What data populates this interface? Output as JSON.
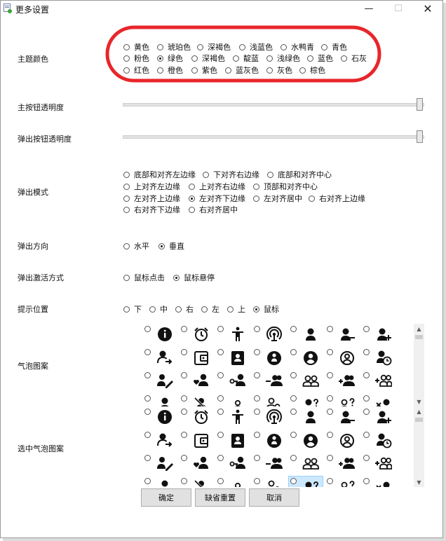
{
  "window": {
    "title": "更多设置"
  },
  "theme": {
    "label": "主题颜色",
    "selected": "绿色",
    "options": [
      "黄色",
      "琥珀色",
      "深褐色",
      "浅蓝色",
      "水鸭青",
      "青色",
      "粉色",
      "绿色",
      "深褐色",
      "靛蓝",
      "浅绿色",
      "蓝色",
      "石灰",
      "红色",
      "橙色",
      "紫色",
      "蓝灰色",
      "灰色",
      "棕色"
    ],
    "highlight_color": "#e8262b"
  },
  "main_opacity": {
    "label": "主按钮透明度",
    "value": 1.0
  },
  "popup_opacity": {
    "label": "弹出按钮透明度",
    "value": 1.0
  },
  "popup_mode": {
    "label": "弹出模式",
    "selected": "左对齐下边缘",
    "options": [
      "底部和对齐左边缘",
      "下对齐右边缘",
      "底部和对齐中心",
      "上对齐左边缘",
      "上对齐右边缘",
      "顶部和对齐中心",
      "左对齐上边缘",
      "左对齐下边缘",
      "左对齐居中",
      "右对齐上边缘",
      "右对齐下边缘",
      "右对齐居中"
    ]
  },
  "popup_direction": {
    "label": "弹出方向",
    "selected": "垂直",
    "options": [
      "水平",
      "垂直"
    ]
  },
  "popup_activation": {
    "label": "弹出激活方式",
    "selected": "鼠标悬停",
    "options": [
      "鼠标点击",
      "鼠标悬停"
    ]
  },
  "tip_position": {
    "label": "提示位置",
    "selected": "鼠标",
    "options": [
      "下",
      "中",
      "右",
      "左",
      "上",
      "鼠标"
    ]
  },
  "bubble_icons": {
    "label": "气泡图案"
  },
  "selected_bubble_icons": {
    "label": "选中气泡图案",
    "highlighted_index": 25
  },
  "icon_names": [
    "info-icon",
    "alarm-clock-icon",
    "accessibility-icon",
    "wifi-tethering-icon",
    "person-icon",
    "person-remove-icon",
    "person-add-icon",
    "person-arrow-icon",
    "wallet-icon",
    "contact-card-icon",
    "face-badge-icon",
    "account-circle-icon",
    "account-circle-outline-icon",
    "person-clock-icon",
    "person-edit-icon",
    "person-heart-icon",
    "person-key-icon",
    "people-remove-icon",
    "people-outline-icon",
    "people-add-icon",
    "people-add-outline-icon",
    "person-small-icon",
    "person-slash-icon",
    "person-tiny-icon",
    "person-search-icon",
    "person-question-icon",
    "person-question-outline-icon",
    "person-x-icon"
  ],
  "buttons": {
    "ok": "确定",
    "reset": "缺省重置",
    "cancel": "取消"
  }
}
